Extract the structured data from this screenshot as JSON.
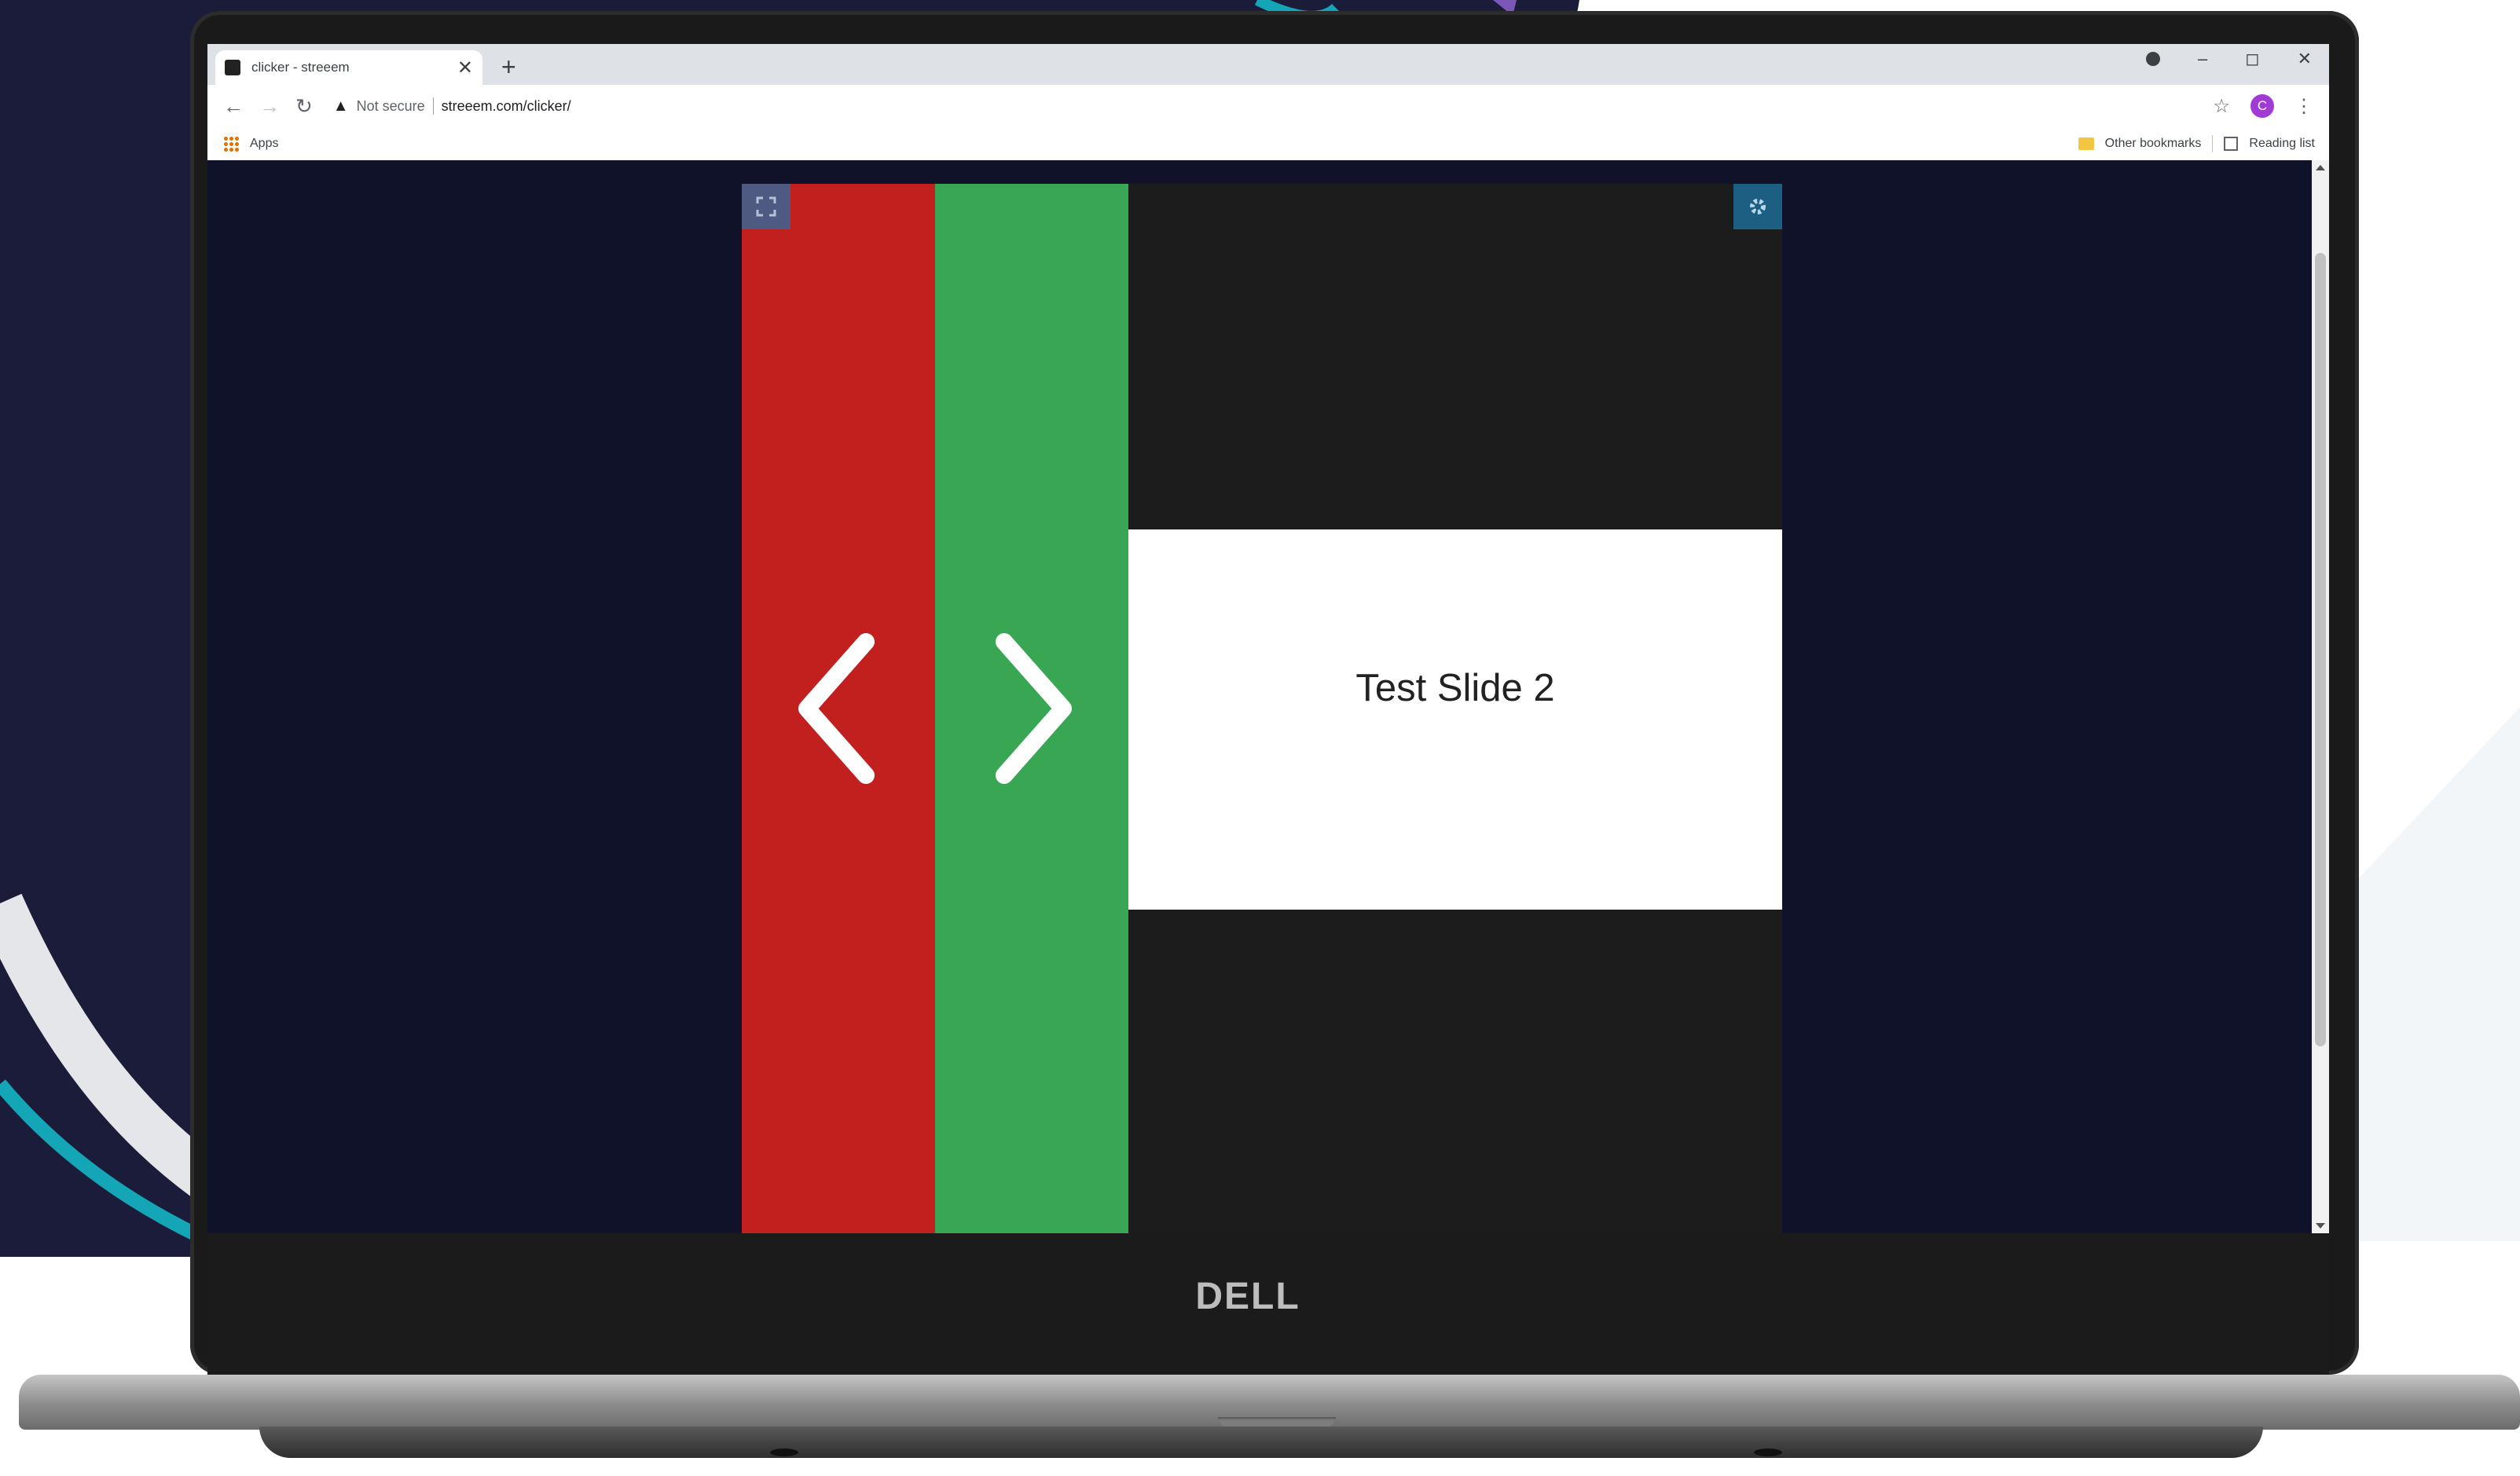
{
  "browser": {
    "tab_title": "clicker - streeem",
    "tab_close": "✕",
    "new_tab": "+",
    "window_controls": {
      "minimize": "–",
      "restore": "◻",
      "close": "✕"
    },
    "security_label": "Not secure",
    "url": "streeem.com/clicker/",
    "profile_initial": "C"
  },
  "bookmarks": {
    "apps_label": "Apps",
    "other_bookmarks_label": "Other bookmarks",
    "reading_list_label": "Reading list"
  },
  "clicker": {
    "prev_icon": "chevron-left-icon",
    "next_icon": "chevron-right-icon",
    "fullscreen_icon": "fullscreen-icon",
    "settings_icon": "gear-icon",
    "slide_title": "Test Slide 2"
  },
  "laptop": {
    "brand": "DELL"
  },
  "colors": {
    "prev_button": "#c1201e",
    "next_button": "#38a652",
    "page_background": "#10122a",
    "settings_button": "#1c5f83",
    "fullscreen_button": "#4f5a83"
  }
}
